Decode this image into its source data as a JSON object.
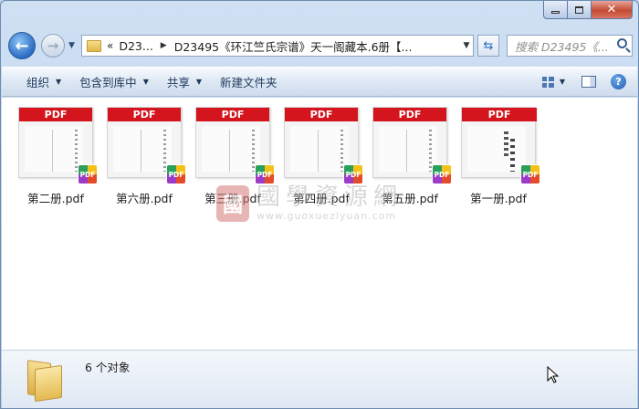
{
  "window": {
    "minimize_label": "",
    "maximize_label": "",
    "close_label": "✕"
  },
  "nav": {
    "breadcrumb": {
      "overflow": "«",
      "parent": "D23...",
      "current": "D23495《环江竺氏宗谱》天一阁藏本.6册【..."
    },
    "search_placeholder": "搜索 D23495《..."
  },
  "toolbar": {
    "organize": "组织",
    "include_in_library": "包含到库中",
    "share": "共享",
    "new_folder": "新建文件夹"
  },
  "files": [
    {
      "name": "第二册.pdf",
      "badge": "PDF",
      "band": "PDF"
    },
    {
      "name": "第六册.pdf",
      "badge": "PDF",
      "band": "PDF"
    },
    {
      "name": "第三册.pdf",
      "badge": "PDF",
      "band": "PDF"
    },
    {
      "name": "第四册.pdf",
      "badge": "PDF",
      "band": "PDF"
    },
    {
      "name": "第五册.pdf",
      "badge": "PDF",
      "band": "PDF"
    },
    {
      "name": "第一册.pdf",
      "badge": "PDF",
      "band": "PDF"
    }
  ],
  "watermark": {
    "seal": "國",
    "chinese": "國學資源網",
    "url": "www.guoxueziyuan.com"
  },
  "details": {
    "count": "6 个对象"
  },
  "colors": {
    "pdf_band": "#d4151e",
    "accent": "#2a6cc4"
  }
}
